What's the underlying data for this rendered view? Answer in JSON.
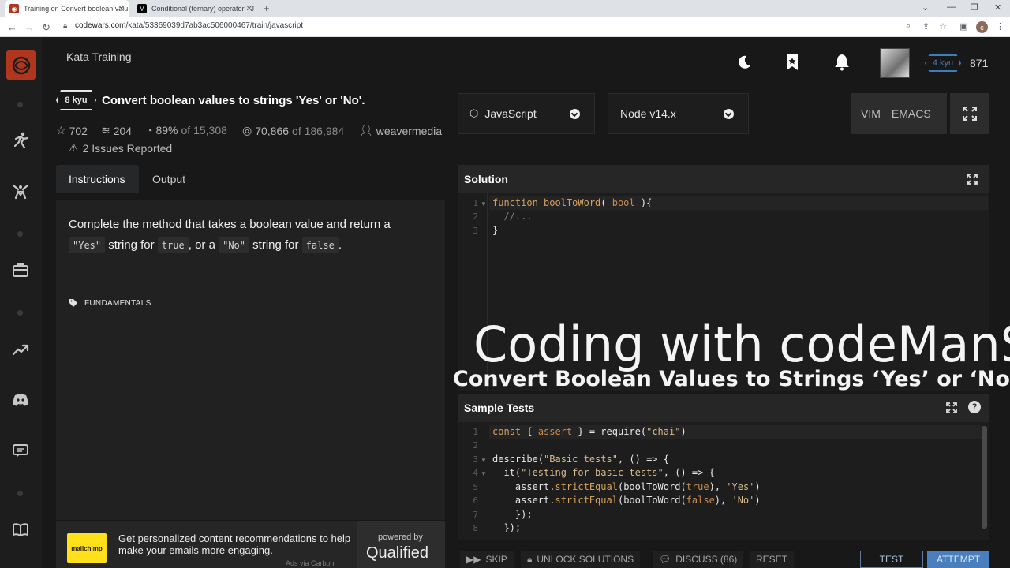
{
  "browser": {
    "tabs": [
      {
        "title": "Training on Convert boolean valu",
        "active": true
      },
      {
        "title": "Conditional (ternary) operator - J",
        "active": false
      }
    ],
    "url_host": "codewars.com",
    "url_path": "/kata/53369039d7ab3ac506000467/train/javascript",
    "profile_initial": "c"
  },
  "header": {
    "section_title": "Kata Training",
    "rank": "4 kyu",
    "honor": "871"
  },
  "kata": {
    "kyu": "8 kyu",
    "title": "Convert boolean values to strings 'Yes' or 'No'.",
    "stats": {
      "stars": "702",
      "collections": "204",
      "satisfaction": "89%",
      "satisfaction_of": "of 15,308",
      "completed": "70,866",
      "completed_of": "of 186,984",
      "author": "weavermedia"
    },
    "issues": "2 Issues Reported"
  },
  "left_tabs": [
    {
      "label": "Instructions",
      "active": true
    },
    {
      "label": "Output",
      "active": false
    }
  ],
  "instructions": {
    "p1": "Complete the method that takes a boolean value and return a",
    "code_yes": "\"Yes\"",
    "t_string_for": "string for",
    "code_true": "true",
    "t_or_a": ", or a",
    "code_no": "\"No\"",
    "t_string_for2": "string for",
    "code_false": "false",
    "t_period": ".",
    "tag": "FUNDAMENTALS"
  },
  "ad": {
    "logo_text": "mailchimp",
    "text": "Get personalized content recommendations to help make your emails more engaging.",
    "via": "Ads via Carbon",
    "powered_by": "powered by",
    "qualified": "Qualified"
  },
  "toolbar": {
    "language": "JavaScript",
    "version": "Node v14.x",
    "vim": "VIM",
    "emacs": "EMACS"
  },
  "solution": {
    "label": "Solution",
    "lines": [
      "1",
      "2",
      "3"
    ]
  },
  "overlay": {
    "title": "Coding with codeManS",
    "subtitle": "Convert Boolean Values to Strings ‘Yes’ or ‘No’"
  },
  "tests": {
    "label": "Sample Tests",
    "lines": [
      "1",
      "2",
      "3",
      "4",
      "5",
      "6",
      "7",
      "8"
    ]
  },
  "buttons": {
    "skip": "SKIP",
    "unlock": "UNLOCK SOLUTIONS",
    "discuss": "DISCUSS (86)",
    "reset": "RESET",
    "test": "TEST",
    "attempt": "ATTEMPT"
  },
  "colors": {
    "brand": "#b1361e",
    "rank_blue": "#3c7ebb",
    "attempt_blue": "#4a7fbf",
    "code_keyword": "#d5a15c"
  }
}
